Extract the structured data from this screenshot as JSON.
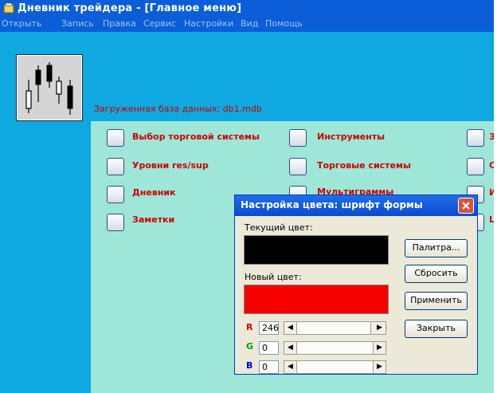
{
  "window": {
    "title": "Дневник трейдера - [Главное меню]",
    "db_loaded_text": "Загруженная база данных: db1.mdb",
    "colors": {
      "titlebar": "#0b5ed8",
      "background": "#0fa8e0",
      "panel": "#9ee6d8",
      "label": "#cc0000"
    }
  },
  "menu": [
    "Открыть",
    "Запись",
    "Правка",
    "Сервис",
    "Настройки",
    "Вид",
    "Помощь"
  ],
  "main_buttons": {
    "col1": [
      "Выбор торговой системы",
      "Уровни res/sup",
      "Дневник",
      "Заметки"
    ],
    "col2": [
      "Инструменты",
      "Торговые системы",
      "Мультиграммы"
    ],
    "col3": [
      "З",
      "С",
      "И",
      "Ц"
    ]
  },
  "dialog": {
    "title": "Настройка цвета: шрифт формы",
    "current_label": "Текущий цвет:",
    "current_color": "#000000",
    "new_label": "Новый цвет:",
    "new_color": "#f60000",
    "buttons": {
      "palette": "Палитра...",
      "reset": "Сбросить",
      "apply": "Применить",
      "close": "Закрыть"
    },
    "channels": [
      {
        "name": "R",
        "value": "246",
        "fraction": 0.965,
        "color": "#e00000"
      },
      {
        "name": "G",
        "value": "0",
        "fraction": 0,
        "color": "#00a000"
      },
      {
        "name": "B",
        "value": "0",
        "fraction": 0,
        "color": "#0000d0"
      }
    ]
  }
}
